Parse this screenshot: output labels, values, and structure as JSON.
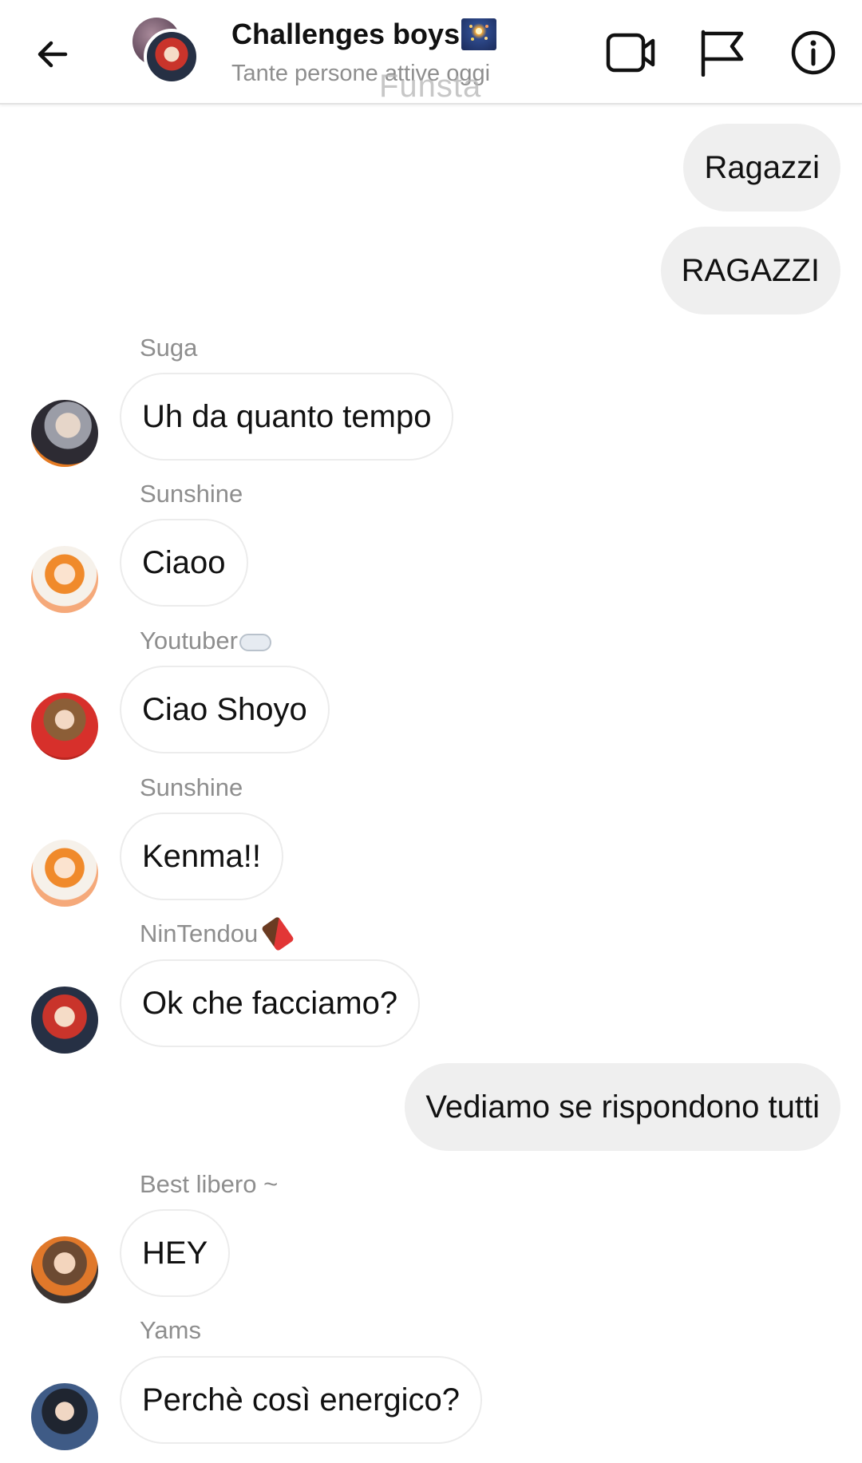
{
  "header": {
    "title": "Challenges boys",
    "title_emoji": "fireworks-emoji",
    "subtitle": "Tante persone attive oggi",
    "watermark": "Funsta",
    "icons": [
      "back-arrow-icon",
      "video-call-icon",
      "flag-icon",
      "info-icon"
    ]
  },
  "colors": {
    "incoming_bubble_bg": "#ffffff",
    "incoming_bubble_border": "#ececec",
    "outgoing_bubble_bg": "#efefef",
    "secondary_text": "#8e8e8e"
  },
  "messages": [
    {
      "direction": "out",
      "text": "Ragazzi"
    },
    {
      "direction": "out",
      "text": "RAGAZZI"
    },
    {
      "direction": "in",
      "sender": "Suga",
      "text": "Uh da quanto tempo"
    },
    {
      "direction": "in",
      "sender": "Sunshine",
      "text": "Ciaoo"
    },
    {
      "direction": "in",
      "sender": "Youtuber",
      "sender_emoji": "cloud-emoji",
      "text": "Ciao Shoyo"
    },
    {
      "direction": "in",
      "sender": "Sunshine",
      "text": "Kenma!!"
    },
    {
      "direction": "in",
      "sender": "NinTendou",
      "sender_emoji": "chocolate-emoji",
      "text": "Ok che facciamo?"
    },
    {
      "direction": "out",
      "text": "Vediamo se rispondono tutti"
    },
    {
      "direction": "in",
      "sender": "Best libero ~",
      "text": "HEY"
    },
    {
      "direction": "in",
      "sender": "Yams",
      "text": "Perchè così energico?"
    }
  ]
}
